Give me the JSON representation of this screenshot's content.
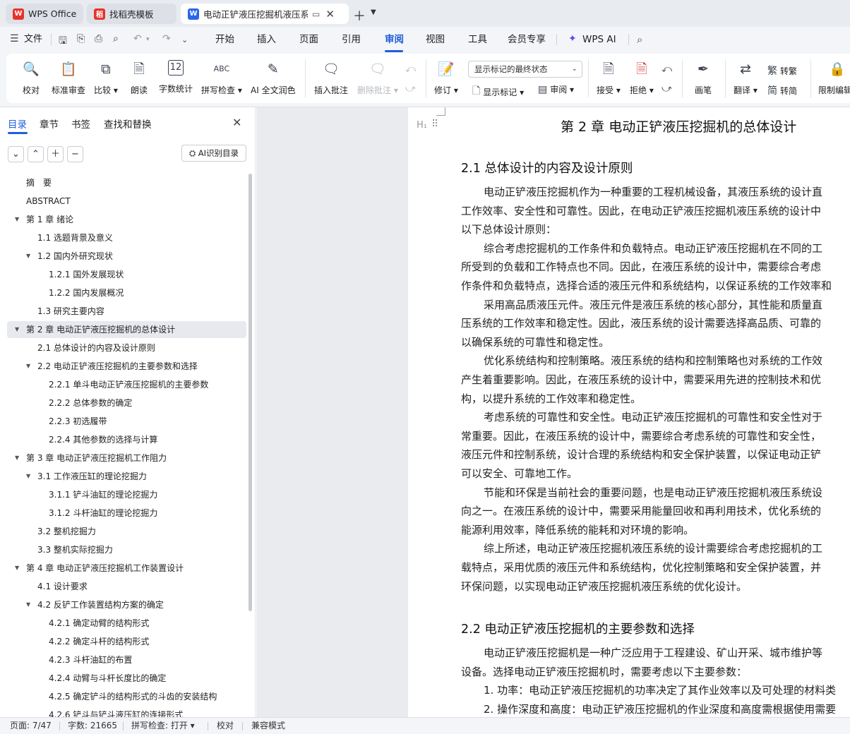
{
  "titlebar": {
    "tabs": [
      {
        "label": "WPS Office",
        "logo": "W",
        "logo_color": "#e8332a"
      },
      {
        "label": "找稻壳模板",
        "logo": "稻",
        "logo_color": "#e8332a"
      },
      {
        "label": "电动正铲液压挖掘机液压系统",
        "logo": "W",
        "logo_color": "#2b66e6"
      }
    ]
  },
  "menubar": {
    "file": "文件",
    "tabs": [
      "开始",
      "插入",
      "页面",
      "引用",
      "审阅",
      "视图",
      "工具",
      "会员专享",
      "WPS AI"
    ]
  },
  "ribbon": {
    "buttons": [
      {
        "label": "校对",
        "icon": "proofread-icon"
      },
      {
        "label": "标准审查",
        "icon": "standard-review-icon"
      },
      {
        "label": "比较 ▾",
        "icon": "compare-icon"
      },
      {
        "label": "朗读",
        "icon": "read-aloud-icon"
      },
      {
        "label": "字数统计",
        "icon": "word-count-icon"
      },
      {
        "label": "拼写检查 ▾",
        "icon": "spellcheck-icon"
      },
      {
        "label": "AI 全文润色",
        "icon": "ai-polish-icon"
      },
      {
        "label": "插入批注",
        "icon": "insert-comment-icon"
      },
      {
        "label": "删除批注 ▾",
        "icon": "delete-comment-icon"
      },
      {
        "label": "修订 ▾",
        "icon": "track-changes-icon"
      },
      {
        "label": "接受 ▾",
        "icon": "accept-icon"
      },
      {
        "label": "拒绝 ▾",
        "icon": "reject-icon"
      },
      {
        "label": "画笔",
        "icon": "pen-icon"
      },
      {
        "label": "翻译 ▾",
        "icon": "translate-icon"
      },
      {
        "label": "限制编辑",
        "icon": "restrict-edit-icon"
      }
    ],
    "markup_select": "显示标记的最终状态",
    "show_markup": "显示标记 ▾",
    "review_pane": "审阅 ▾",
    "to_traditional": "转繁",
    "to_simplified": "转简",
    "ribbon_icon_text": {
      "word_count": "12",
      "spellcheck": "ABC"
    }
  },
  "navpane": {
    "tabs": [
      "目录",
      "章节",
      "书签",
      "查找和替换"
    ],
    "ai_button": "AI识别目录",
    "toc": [
      {
        "label": "摘　要",
        "level": 1,
        "arrow": false
      },
      {
        "label": "ABSTRACT",
        "level": 1,
        "arrow": false
      },
      {
        "label": "第 1 章  绪论",
        "level": 1,
        "arrow": true
      },
      {
        "label": "1.1  选题背景及意义",
        "level": 2,
        "arrow": false
      },
      {
        "label": "1.2  国内外研究现状",
        "level": 2,
        "arrow": true
      },
      {
        "label": "1.2.1 国外发展现状",
        "level": 3,
        "arrow": false
      },
      {
        "label": "1.2.2 国内发展概况",
        "level": 3,
        "arrow": false
      },
      {
        "label": "1.3  研究主要内容",
        "level": 2,
        "arrow": false
      },
      {
        "label": "第 2 章  电动正铲液压挖掘机的总体设计",
        "level": 1,
        "arrow": true,
        "selected": true
      },
      {
        "label": "2.1  总体设计的内容及设计原则",
        "level": 2,
        "arrow": false
      },
      {
        "label": "2.2  电动正铲液压挖掘机的主要参数和选择",
        "level": 2,
        "arrow": true
      },
      {
        "label": "2.2.1  单斗电动正铲液压挖掘机的主要参数",
        "level": 3,
        "arrow": false
      },
      {
        "label": "2.2.2  总体参数的确定",
        "level": 3,
        "arrow": false
      },
      {
        "label": "2.2.3 初选履带",
        "level": 3,
        "arrow": false
      },
      {
        "label": "2.2.4 其他参数的选择与计算",
        "level": 3,
        "arrow": false
      },
      {
        "label": "第 3 章  电动正铲液压挖掘机工作阻力",
        "level": 1,
        "arrow": true
      },
      {
        "label": "3.1  工作液压缸的理论挖掘力",
        "level": 2,
        "arrow": true
      },
      {
        "label": "3.1.1 铲斗油缸的理论挖掘力",
        "level": 3,
        "arrow": false
      },
      {
        "label": "3.1.2  斗杆油缸的理论挖掘力",
        "level": 3,
        "arrow": false
      },
      {
        "label": "3.2  整机挖掘力",
        "level": 2,
        "arrow": false
      },
      {
        "label": "3.3  整机实际挖掘力",
        "level": 2,
        "arrow": false
      },
      {
        "label": "第 4 章  电动正铲液压挖掘机工作装置设计",
        "level": 1,
        "arrow": true
      },
      {
        "label": "4.1 设计要求",
        "level": 2,
        "arrow": false
      },
      {
        "label": "4.2 反铲工作装置结构方案的确定",
        "level": 2,
        "arrow": true
      },
      {
        "label": "4.2.1 确定动臂的结构形式",
        "level": 3,
        "arrow": false
      },
      {
        "label": "4.2.2 确定斗杆的结构形式",
        "level": 3,
        "arrow": false
      },
      {
        "label": "4.2.3 斗杆油缸的布置",
        "level": 3,
        "arrow": false
      },
      {
        "label": "4.2.4 动臂与斗杆长度比的确定",
        "level": 3,
        "arrow": false
      },
      {
        "label": "4.2.5 确定铲斗的结构形式的斗齿的安装结构",
        "level": 3,
        "arrow": false
      },
      {
        "label": "4.2.6 铲斗与铲斗液压缸的连接形式",
        "level": 3,
        "arrow": false
      }
    ]
  },
  "document": {
    "h1": "第 2 章  电动正铲液压挖掘机的总体设计",
    "h2_a": "2.1  总体设计的内容及设计原则",
    "h2_b": "2.2  电动正铲液压挖掘机的主要参数和选择",
    "block1": [
      {
        "text": "电动正铲液压挖掘机作为一种重要的工程机械设备，其液压系统的设计直",
        "indent": true
      },
      {
        "text": "工作效率、安全性和可靠性。因此，在电动正铲液压挖掘机液压系统的设计中",
        "indent": false
      },
      {
        "text": "以下总体设计原则：",
        "indent": false
      },
      {
        "text": "综合考虑挖掘机的工作条件和负载特点。电动正铲液压挖掘机在不同的工",
        "indent": true
      },
      {
        "text": "所受到的负载和工作特点也不同。因此，在液压系统的设计中，需要综合考虑",
        "indent": false
      },
      {
        "text": "作条件和负载特点，选择合适的液压元件和系统结构，以保证系统的工作效率和",
        "indent": false
      },
      {
        "text": "采用高品质液压元件。液压元件是液压系统的核心部分，其性能和质量直",
        "indent": true
      },
      {
        "text": "压系统的工作效率和稳定性。因此，液压系统的设计需要选择高品质、可靠的",
        "indent": false
      },
      {
        "text": "以确保系统的可靠性和稳定性。",
        "indent": false
      },
      {
        "text": "优化系统结构和控制策略。液压系统的结构和控制策略也对系统的工作效",
        "indent": true
      },
      {
        "text": "产生着重要影响。因此，在液压系统的设计中，需要采用先进的控制技术和优",
        "indent": false
      },
      {
        "text": "构，以提升系统的工作效率和稳定性。",
        "indent": false
      },
      {
        "text": "考虑系统的可靠性和安全性。电动正铲液压挖掘机的可靠性和安全性对于",
        "indent": true
      },
      {
        "text": "常重要。因此，在液压系统的设计中，需要综合考虑系统的可靠性和安全性，",
        "indent": false
      },
      {
        "text": "液压元件和控制系统，设计合理的系统结构和安全保护装置，以保证电动正铲",
        "indent": false
      },
      {
        "text": "可以安全、可靠地工作。",
        "indent": false
      },
      {
        "text": "节能和环保是当前社会的重要问题，也是电动正铲液压挖掘机液压系统设",
        "indent": true
      },
      {
        "text": "向之一。在液压系统的设计中，需要采用能量回收和再利用技术，优化系统的",
        "indent": false
      },
      {
        "text": "能源利用效率，降低系统的能耗和对环境的影响。",
        "indent": false
      },
      {
        "text": "综上所述，电动正铲液压挖掘机液压系统的设计需要综合考虑挖掘机的工",
        "indent": true
      },
      {
        "text": "载特点，采用优质的液压元件和系统结构，优化控制策略和安全保护装置，并",
        "indent": false
      },
      {
        "text": "环保问题，以实现电动正铲液压挖掘机液压系统的优化设计。",
        "indent": false
      }
    ],
    "block2": [
      {
        "text": "电动正铲液压挖掘机是一种广泛应用于工程建设、矿山开采、城市维护等",
        "indent": true
      },
      {
        "text": "设备。选择电动正铲液压挖掘机时，需要考虑以下主要参数：",
        "indent": false
      },
      {
        "text": "1. 功率：电动正铲液压挖掘机的功率决定了其作业效率以及可处理的材料类",
        "indent": true
      },
      {
        "text": "2. 操作深度和高度：电动正铲液压挖掘机的作业深度和高度需根据使用需要",
        "indent": true
      }
    ]
  },
  "statusbar": {
    "page": "页面: 7/47",
    "words": "字数: 21665",
    "spell": "拼写检查: 打开 ▾",
    "proof": "校对",
    "compat": "兼容模式"
  }
}
